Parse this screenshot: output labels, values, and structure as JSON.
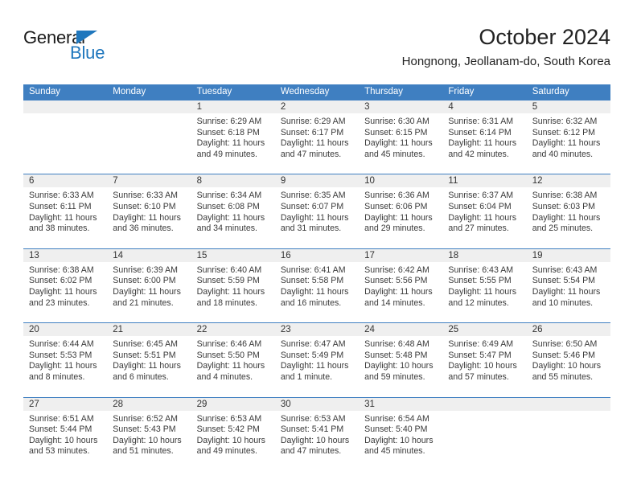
{
  "logo": {
    "word1": "General",
    "word2": "Blue",
    "triangle_color": "#1f77bd"
  },
  "header": {
    "title": "October 2024",
    "subtitle": "Hongnong, Jeollanam-do, South Korea"
  },
  "colors": {
    "header_bar": "#3f7fc1",
    "daynum_band": "#efefef",
    "text": "#3a3a3a"
  },
  "day_names": [
    "Sunday",
    "Monday",
    "Tuesday",
    "Wednesday",
    "Thursday",
    "Friday",
    "Saturday"
  ],
  "labels": {
    "sunrise": "Sunrise:",
    "sunset": "Sunset:",
    "daylight": "Daylight:"
  },
  "weeks": [
    [
      {
        "day": "",
        "empty": true
      },
      {
        "day": "",
        "empty": true
      },
      {
        "day": "1",
        "sunrise": "Sunrise: 6:29 AM",
        "sunset": "Sunset: 6:18 PM",
        "daylight": "Daylight: 11 hours and 49 minutes."
      },
      {
        "day": "2",
        "sunrise": "Sunrise: 6:29 AM",
        "sunset": "Sunset: 6:17 PM",
        "daylight": "Daylight: 11 hours and 47 minutes."
      },
      {
        "day": "3",
        "sunrise": "Sunrise: 6:30 AM",
        "sunset": "Sunset: 6:15 PM",
        "daylight": "Daylight: 11 hours and 45 minutes."
      },
      {
        "day": "4",
        "sunrise": "Sunrise: 6:31 AM",
        "sunset": "Sunset: 6:14 PM",
        "daylight": "Daylight: 11 hours and 42 minutes."
      },
      {
        "day": "5",
        "sunrise": "Sunrise: 6:32 AM",
        "sunset": "Sunset: 6:12 PM",
        "daylight": "Daylight: 11 hours and 40 minutes."
      }
    ],
    [
      {
        "day": "6",
        "sunrise": "Sunrise: 6:33 AM",
        "sunset": "Sunset: 6:11 PM",
        "daylight": "Daylight: 11 hours and 38 minutes."
      },
      {
        "day": "7",
        "sunrise": "Sunrise: 6:33 AM",
        "sunset": "Sunset: 6:10 PM",
        "daylight": "Daylight: 11 hours and 36 minutes."
      },
      {
        "day": "8",
        "sunrise": "Sunrise: 6:34 AM",
        "sunset": "Sunset: 6:08 PM",
        "daylight": "Daylight: 11 hours and 34 minutes."
      },
      {
        "day": "9",
        "sunrise": "Sunrise: 6:35 AM",
        "sunset": "Sunset: 6:07 PM",
        "daylight": "Daylight: 11 hours and 31 minutes."
      },
      {
        "day": "10",
        "sunrise": "Sunrise: 6:36 AM",
        "sunset": "Sunset: 6:06 PM",
        "daylight": "Daylight: 11 hours and 29 minutes."
      },
      {
        "day": "11",
        "sunrise": "Sunrise: 6:37 AM",
        "sunset": "Sunset: 6:04 PM",
        "daylight": "Daylight: 11 hours and 27 minutes."
      },
      {
        "day": "12",
        "sunrise": "Sunrise: 6:38 AM",
        "sunset": "Sunset: 6:03 PM",
        "daylight": "Daylight: 11 hours and 25 minutes."
      }
    ],
    [
      {
        "day": "13",
        "sunrise": "Sunrise: 6:38 AM",
        "sunset": "Sunset: 6:02 PM",
        "daylight": "Daylight: 11 hours and 23 minutes."
      },
      {
        "day": "14",
        "sunrise": "Sunrise: 6:39 AM",
        "sunset": "Sunset: 6:00 PM",
        "daylight": "Daylight: 11 hours and 21 minutes."
      },
      {
        "day": "15",
        "sunrise": "Sunrise: 6:40 AM",
        "sunset": "Sunset: 5:59 PM",
        "daylight": "Daylight: 11 hours and 18 minutes."
      },
      {
        "day": "16",
        "sunrise": "Sunrise: 6:41 AM",
        "sunset": "Sunset: 5:58 PM",
        "daylight": "Daylight: 11 hours and 16 minutes."
      },
      {
        "day": "17",
        "sunrise": "Sunrise: 6:42 AM",
        "sunset": "Sunset: 5:56 PM",
        "daylight": "Daylight: 11 hours and 14 minutes."
      },
      {
        "day": "18",
        "sunrise": "Sunrise: 6:43 AM",
        "sunset": "Sunset: 5:55 PM",
        "daylight": "Daylight: 11 hours and 12 minutes."
      },
      {
        "day": "19",
        "sunrise": "Sunrise: 6:43 AM",
        "sunset": "Sunset: 5:54 PM",
        "daylight": "Daylight: 11 hours and 10 minutes."
      }
    ],
    [
      {
        "day": "20",
        "sunrise": "Sunrise: 6:44 AM",
        "sunset": "Sunset: 5:53 PM",
        "daylight": "Daylight: 11 hours and 8 minutes."
      },
      {
        "day": "21",
        "sunrise": "Sunrise: 6:45 AM",
        "sunset": "Sunset: 5:51 PM",
        "daylight": "Daylight: 11 hours and 6 minutes."
      },
      {
        "day": "22",
        "sunrise": "Sunrise: 6:46 AM",
        "sunset": "Sunset: 5:50 PM",
        "daylight": "Daylight: 11 hours and 4 minutes."
      },
      {
        "day": "23",
        "sunrise": "Sunrise: 6:47 AM",
        "sunset": "Sunset: 5:49 PM",
        "daylight": "Daylight: 11 hours and 1 minute."
      },
      {
        "day": "24",
        "sunrise": "Sunrise: 6:48 AM",
        "sunset": "Sunset: 5:48 PM",
        "daylight": "Daylight: 10 hours and 59 minutes."
      },
      {
        "day": "25",
        "sunrise": "Sunrise: 6:49 AM",
        "sunset": "Sunset: 5:47 PM",
        "daylight": "Daylight: 10 hours and 57 minutes."
      },
      {
        "day": "26",
        "sunrise": "Sunrise: 6:50 AM",
        "sunset": "Sunset: 5:46 PM",
        "daylight": "Daylight: 10 hours and 55 minutes."
      }
    ],
    [
      {
        "day": "27",
        "sunrise": "Sunrise: 6:51 AM",
        "sunset": "Sunset: 5:44 PM",
        "daylight": "Daylight: 10 hours and 53 minutes."
      },
      {
        "day": "28",
        "sunrise": "Sunrise: 6:52 AM",
        "sunset": "Sunset: 5:43 PM",
        "daylight": "Daylight: 10 hours and 51 minutes."
      },
      {
        "day": "29",
        "sunrise": "Sunrise: 6:53 AM",
        "sunset": "Sunset: 5:42 PM",
        "daylight": "Daylight: 10 hours and 49 minutes."
      },
      {
        "day": "30",
        "sunrise": "Sunrise: 6:53 AM",
        "sunset": "Sunset: 5:41 PM",
        "daylight": "Daylight: 10 hours and 47 minutes."
      },
      {
        "day": "31",
        "sunrise": "Sunrise: 6:54 AM",
        "sunset": "Sunset: 5:40 PM",
        "daylight": "Daylight: 10 hours and 45 minutes."
      },
      {
        "day": "",
        "empty": true
      },
      {
        "day": "",
        "empty": true
      }
    ]
  ]
}
